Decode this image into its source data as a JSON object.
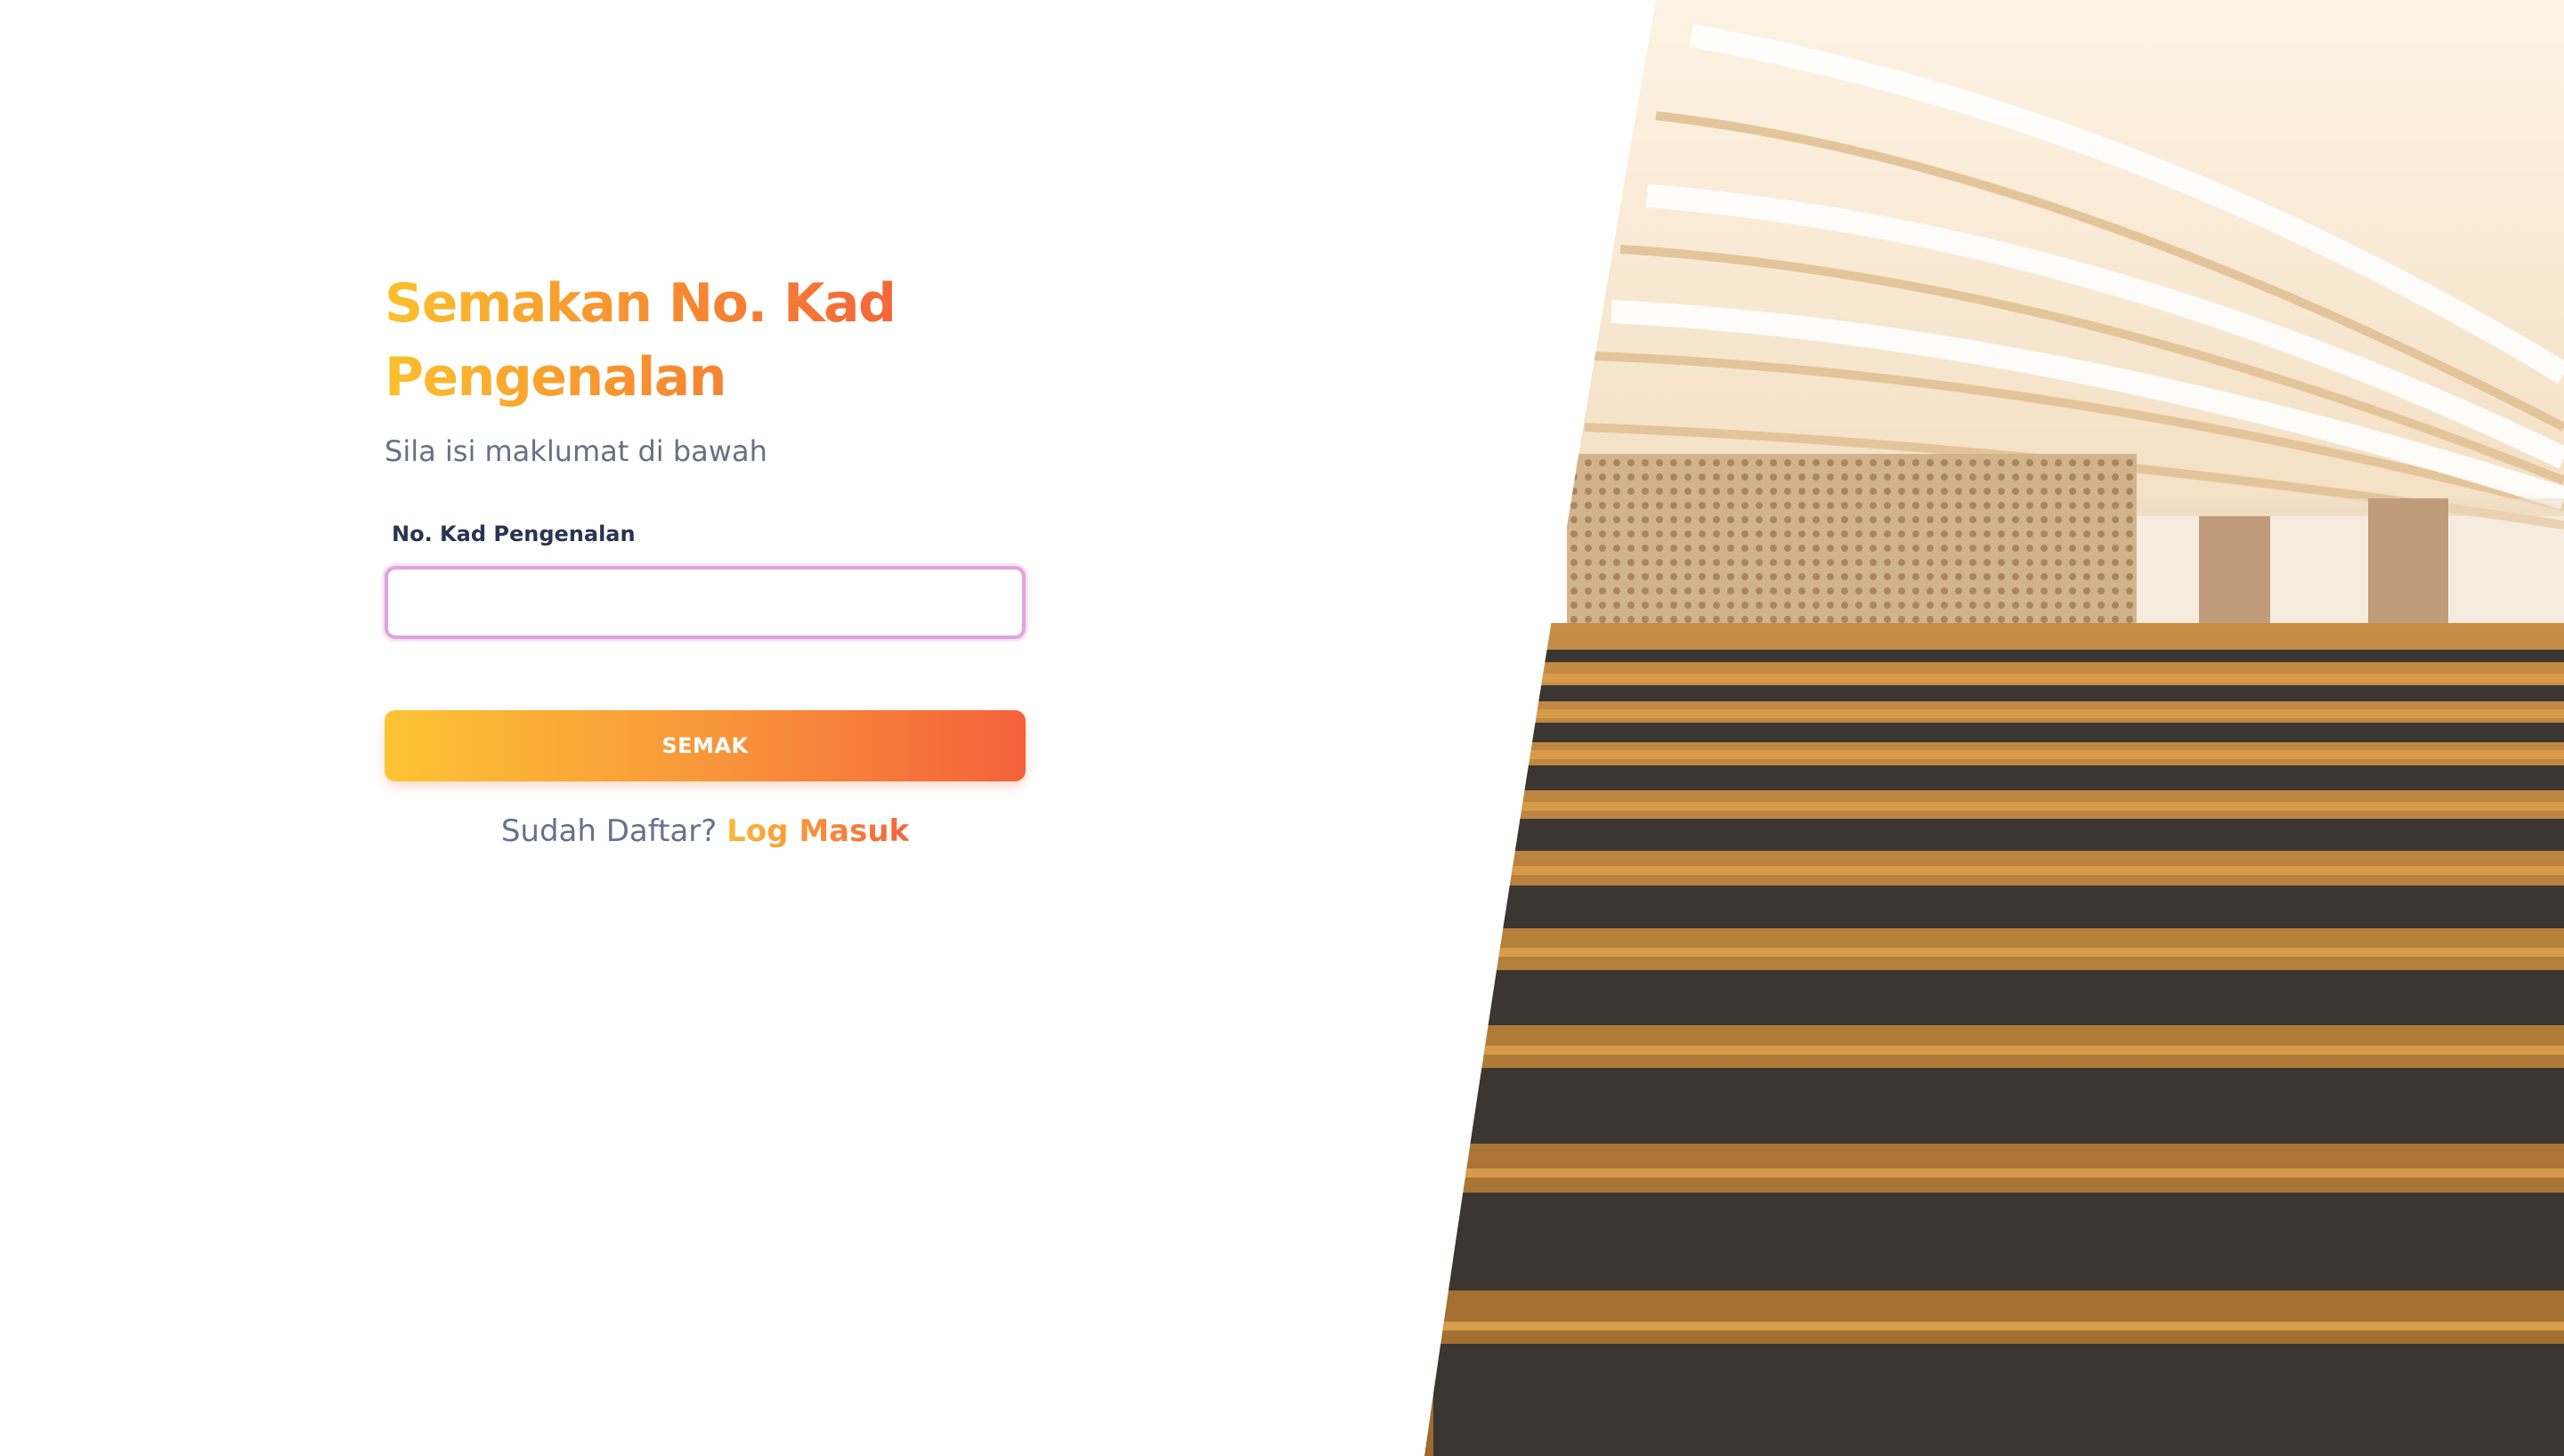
{
  "form": {
    "title": "Semakan No. Kad Pengenalan",
    "subtitle": "Sila isi maklumat di bawah",
    "ic_label": "No. Kad Pengenalan",
    "ic_value": "",
    "submit_label": "SEMAK"
  },
  "footer": {
    "question": "Sudah Daftar?",
    "login_link": "Log Masuk"
  },
  "colors": {
    "accent_start": "#fbc02d",
    "accent_end": "#f4613b",
    "input_border": "#e0a3dd"
  }
}
